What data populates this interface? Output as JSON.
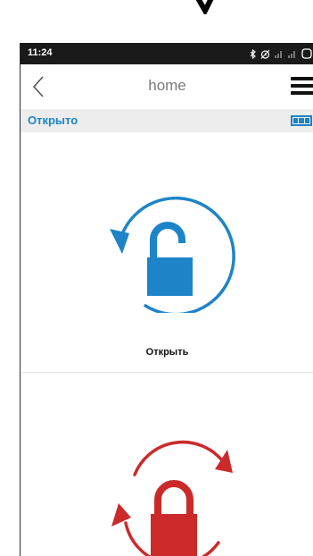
{
  "status_bar": {
    "time": "11:24"
  },
  "nav": {
    "title": "home"
  },
  "state": {
    "text": "Открыто"
  },
  "actions": {
    "unlock_label": "Открыть"
  },
  "colors": {
    "accent_blue": "#1e84c8",
    "lock_red": "#cc2a2a",
    "status_bg": "#1a1a1a"
  },
  "icons": [
    "back-chevron-icon",
    "menu-icon",
    "battery-icon",
    "unlock-rotate-icon",
    "lock-rotate-icon",
    "bluetooth-icon",
    "alarm-icon",
    "signal-icon"
  ]
}
